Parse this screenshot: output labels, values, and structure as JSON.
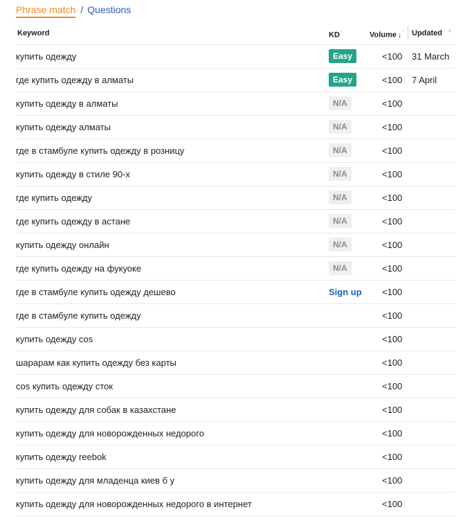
{
  "tabs": {
    "active": "Phrase match",
    "separator": "/",
    "other": "Questions"
  },
  "columns": {
    "keyword": "Keyword",
    "kd": "KD",
    "volume": "Volume",
    "updated": "Updated"
  },
  "icons": {
    "info": "info-icon",
    "sort": "sort-desc-icon",
    "scroll": "chevron-right-icon"
  },
  "colors": {
    "accent": "#f08a24",
    "link": "#2a5db0",
    "easy": "#24a48a"
  },
  "rows": [
    {
      "keyword": "купить одежду",
      "kd": "Easy",
      "kd_type": "easy",
      "volume": "<100",
      "updated": "31 March"
    },
    {
      "keyword": "где купить одежду в алматы",
      "kd": "Easy",
      "kd_type": "easy",
      "volume": "<100",
      "updated": "7 April"
    },
    {
      "keyword": "купить одежду в алматы",
      "kd": "N/A",
      "kd_type": "na",
      "volume": "<100",
      "updated": ""
    },
    {
      "keyword": "купить одежду алматы",
      "kd": "N/A",
      "kd_type": "na",
      "volume": "<100",
      "updated": ""
    },
    {
      "keyword": "где в стамбуле купить одежду в розницу",
      "kd": "N/A",
      "kd_type": "na",
      "volume": "<100",
      "updated": ""
    },
    {
      "keyword": "купить одежду в стиле 90-х",
      "kd": "N/A",
      "kd_type": "na",
      "volume": "<100",
      "updated": ""
    },
    {
      "keyword": "где купить одежду",
      "kd": "N/A",
      "kd_type": "na",
      "volume": "<100",
      "updated": ""
    },
    {
      "keyword": "где купить одежду в астане",
      "kd": "N/A",
      "kd_type": "na",
      "volume": "<100",
      "updated": ""
    },
    {
      "keyword": "купить одежду онлайн",
      "kd": "N/A",
      "kd_type": "na",
      "volume": "<100",
      "updated": ""
    },
    {
      "keyword": "где купить одежду на фукуоке",
      "kd": "N/A",
      "kd_type": "na",
      "volume": "<100",
      "updated": ""
    },
    {
      "keyword": "где в стамбуле купить одежду дешево",
      "kd": "Sign up",
      "kd_type": "signup",
      "volume": "<100",
      "updated": ""
    },
    {
      "keyword": "где в стамбуле купить одежду",
      "kd": "",
      "kd_type": "none",
      "volume": "<100",
      "updated": ""
    },
    {
      "keyword": "купить одежду cos",
      "kd": "",
      "kd_type": "none",
      "volume": "<100",
      "updated": ""
    },
    {
      "keyword": "шарарам как купить одежду без карты",
      "kd": "",
      "kd_type": "none",
      "volume": "<100",
      "updated": ""
    },
    {
      "keyword": "cos купить одежду сток",
      "kd": "",
      "kd_type": "none",
      "volume": "<100",
      "updated": ""
    },
    {
      "keyword": "купить одежду для собак в казахстане",
      "kd": "",
      "kd_type": "none",
      "volume": "<100",
      "updated": ""
    },
    {
      "keyword": "купить одежду для новорожденных недорого",
      "kd": "",
      "kd_type": "none",
      "volume": "<100",
      "updated": ""
    },
    {
      "keyword": "купить одежду reebok",
      "kd": "",
      "kd_type": "none",
      "volume": "<100",
      "updated": ""
    },
    {
      "keyword": "купить одежду для младенца киев б у",
      "kd": "",
      "kd_type": "none",
      "volume": "<100",
      "updated": ""
    },
    {
      "keyword": "купить одежду для новорожденных недорого в интернет",
      "kd": "",
      "kd_type": "none",
      "volume": "<100",
      "updated": ""
    }
  ]
}
